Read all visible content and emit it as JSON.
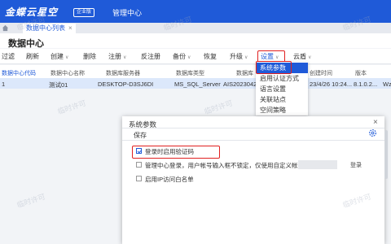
{
  "header": {
    "logo_text": "金蝶云星空",
    "edition_badge": "企业版",
    "app_name": "管理中心"
  },
  "tabs": [
    {
      "label": "数据中心列表",
      "close": "×"
    }
  ],
  "page": {
    "title": "数据中心"
  },
  "toolbar": {
    "items": [
      "过滤",
      "刷新",
      "创建",
      "删除",
      "注册",
      "反注册",
      "备份",
      "恢复",
      "升级",
      "设置",
      "云盾"
    ],
    "dropdown_caret": "∨"
  },
  "grid": {
    "headers": [
      "数据中心代码",
      "数据中心名称",
      "数据库服务器",
      "数据库类型",
      "数据库",
      "创建时间",
      "版本",
      "W"
    ],
    "rows": [
      [
        "1",
        "测试01",
        "DESKTOP-D3SJ6DI",
        "MS_SQL_Server",
        "AIS20230421",
        "23/4/26 10:24...",
        "8.1.0.2...",
        "Wz"
      ]
    ]
  },
  "settings_menu": {
    "items": [
      "系统参数",
      "启用认证方式",
      "语言设置",
      "关联站点",
      "空间策略"
    ],
    "active_index": 0
  },
  "dialog": {
    "title": "系统参数",
    "close": "×",
    "save_label": "保存",
    "options": [
      {
        "label": "登录时启用验证码",
        "checked": true
      },
      {
        "label": "管理中心登录，用户帐号输入框不锁定，仅使用自定义帐号",
        "checked": false
      },
      {
        "label": "启用IP访问白名单",
        "checked": false
      }
    ],
    "login_label": "登录"
  },
  "watermark": "临时许可",
  "colors": {
    "brand": "#1f5ad8",
    "highlight": "#e02020",
    "selected_row": "#dce8fb"
  }
}
